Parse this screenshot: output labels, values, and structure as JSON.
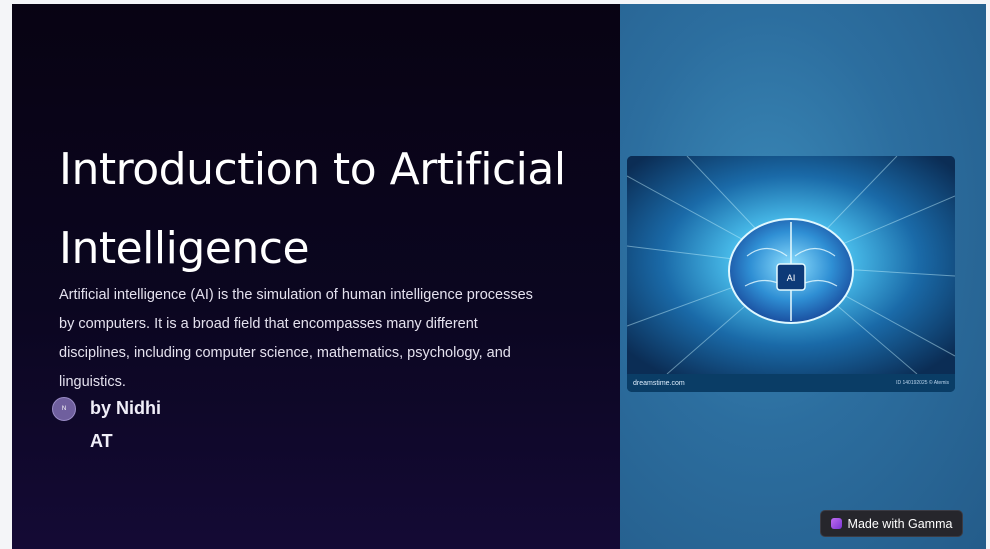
{
  "slide": {
    "title": "Introduction to Artificial Intelligence",
    "body": "Artificial intelligence (AI) is the simulation of human intelligence processes by computers. It is a broad field that encompasses many different disciplines, including computer science, mathematics, psychology, and linguistics.",
    "author": {
      "avatar_initial": "N",
      "name": "by Nidhi",
      "line2": "AT"
    },
    "image": {
      "chip_label": "AI",
      "watermark_left": "dreamstime.com",
      "watermark_right": "ID 140192025 © Atemis"
    }
  },
  "badge": {
    "label": "Made with Gamma",
    "icon": "gamma-logo-icon"
  },
  "colors": {
    "left_bg": "#0b0620",
    "right_bg": "#2c6e9f",
    "badge_bg": "#26262c"
  }
}
